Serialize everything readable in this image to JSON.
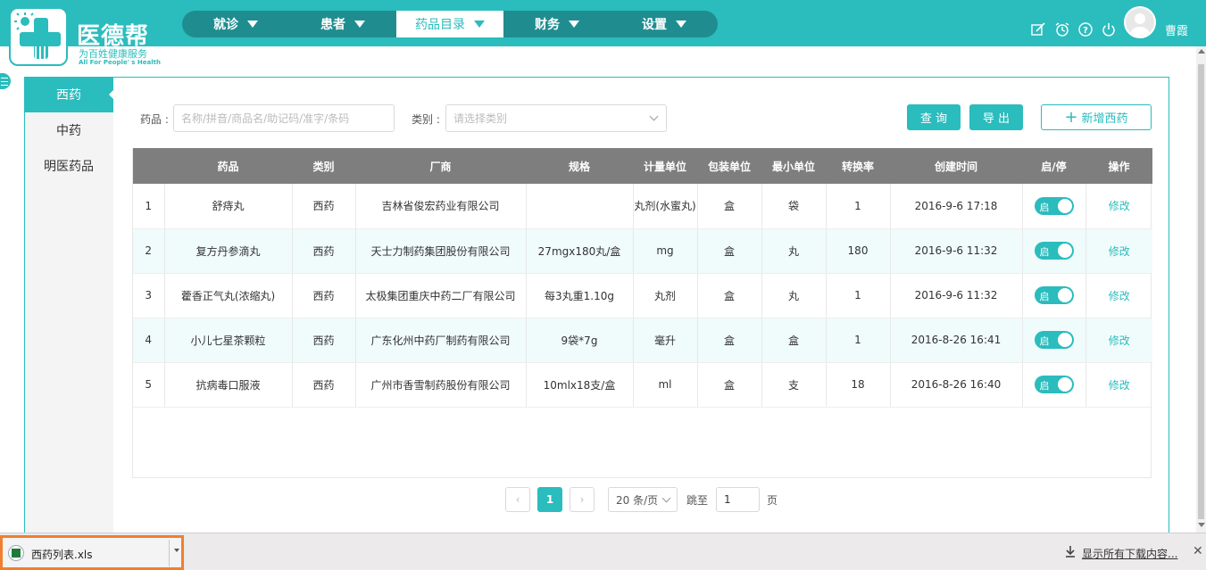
{
  "header": {
    "logo_title": "医德帮",
    "logo_subtitle": "为百姓健康服务",
    "logo_tagline": "All For People' s Health",
    "nav": [
      {
        "label": "就诊",
        "active": false
      },
      {
        "label": "患者",
        "active": false
      },
      {
        "label": "药品目录",
        "active": true
      },
      {
        "label": "财务",
        "active": false
      },
      {
        "label": "设置",
        "active": false
      }
    ],
    "icons": [
      "edit-icon",
      "alarm-icon",
      "help-icon",
      "power-icon"
    ],
    "username": "曹霞"
  },
  "sidebar": {
    "items": [
      {
        "label": "西药",
        "active": true
      },
      {
        "label": "中药",
        "active": false
      },
      {
        "label": "明医药品",
        "active": false
      }
    ]
  },
  "filters": {
    "drug_label": "药品 :",
    "drug_placeholder": "名称/拼音/商品名/助记码/准字/条码",
    "category_label": "类别 :",
    "category_placeholder": "请选择类别"
  },
  "actions": {
    "query": "查 询",
    "export": "导 出",
    "add": "新增西药"
  },
  "table": {
    "headers": [
      "",
      "药品",
      "类别",
      "厂商",
      "规格",
      "计量单位",
      "包装单位",
      "最小单位",
      "转换率",
      "创建时间",
      "启/停",
      "操作"
    ],
    "rows": [
      {
        "no": "1",
        "name": "舒痔丸",
        "category": "西药",
        "maker": "吉林省俊宏药业有限公司",
        "spec": "",
        "unit": "丸剂(水蜜丸)",
        "pack": "盒",
        "min": "袋",
        "rate": "1",
        "created": "2016-9-6 17:18",
        "toggle": "启",
        "op": "修改"
      },
      {
        "no": "2",
        "name": "复方丹参滴丸",
        "category": "西药",
        "maker": "天士力制药集团股份有限公司",
        "spec": "27mgx180丸/盒",
        "unit": "mg",
        "pack": "盒",
        "min": "丸",
        "rate": "180",
        "created": "2016-9-6 11:32",
        "toggle": "启",
        "op": "修改"
      },
      {
        "no": "3",
        "name": "藿香正气丸(浓缩丸)",
        "category": "西药",
        "maker": "太极集团重庆中药二厂有限公司",
        "spec": "每3丸重1.10g",
        "unit": "丸剂",
        "pack": "盒",
        "min": "丸",
        "rate": "1",
        "created": "2016-9-6 11:32",
        "toggle": "启",
        "op": "修改"
      },
      {
        "no": "4",
        "name": "小儿七星茶颗粒",
        "category": "西药",
        "maker": "广东化州中药厂制药有限公司",
        "spec": "9袋*7g",
        "unit": "毫升",
        "pack": "盒",
        "min": "盒",
        "rate": "1",
        "created": "2016-8-26 16:41",
        "toggle": "启",
        "op": "修改"
      },
      {
        "no": "5",
        "name": "抗病毒口服液",
        "category": "西药",
        "maker": "广州市香雪制药股份有限公司",
        "spec": "10mlx18支/盒",
        "unit": "ml",
        "pack": "盒",
        "min": "支",
        "rate": "18",
        "created": "2016-8-26 16:40",
        "toggle": "启",
        "op": "修改"
      }
    ]
  },
  "pagination": {
    "prev": "‹",
    "current": "1",
    "next": "›",
    "page_size": "20 条/页",
    "jump_label": "跳至",
    "jump_value": "1",
    "page_suffix": "页"
  },
  "download_bar": {
    "file_name": "西药列表.xls",
    "show_all": "显示所有下载内容...",
    "close": "✕"
  },
  "colors": {
    "accent": "#2bbcbd",
    "nav_dark": "#1f8d8f",
    "table_header": "#7e7e7e",
    "download_highlight": "#f07f2f"
  }
}
